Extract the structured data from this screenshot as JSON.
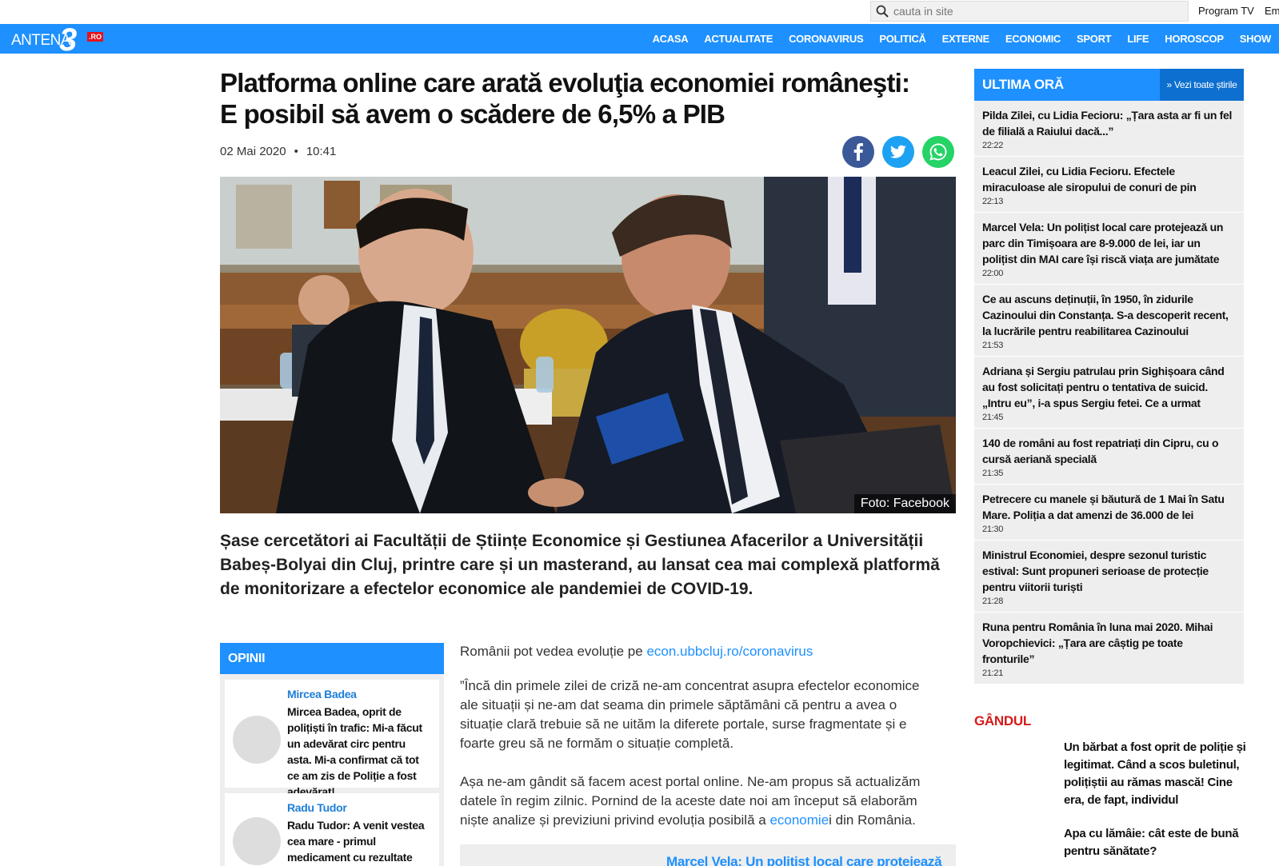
{
  "util": {
    "search_placeholder": "cauta in site",
    "program_tv": "Program TV",
    "em": "Em"
  },
  "logo": {
    "text": "ANTENA",
    "three": "3",
    "ro": ".RO"
  },
  "nav": [
    "ACASA",
    "ACTUALITATE",
    "CORONAVIRUS",
    "POLITICĂ",
    "EXTERNE",
    "ECONOMIC",
    "SPORT",
    "LIFE",
    "HOROSCOP",
    "SHOW"
  ],
  "article": {
    "headline": "Platforma online care arată evoluţia economiei româneşti: E posibil să avem o scădere de 6,5% a PIB",
    "date": "02 Mai 2020",
    "time": "10:41",
    "photo_credit": "Foto: Facebook",
    "lead": "Șase cercetători ai Facultății de Științe Economice și Gestiunea Afacerilor a Universității Babeș-Bolyai din Cluj, printre care și un masterand, au lansat cea mai complexă platformă de monitorizare a efectelor economice ale pandemiei de COVID-19.",
    "p1_prefix": "Românii pot vedea evoluție pe ",
    "p1_link": "econ.ubbcluj.ro/coronavirus",
    "p2": "”Încă din primele zilei de criză ne-am concentrat asupra efectelor economice ale situații și ne-am dat seama din primele săptămâni că pentru a avea o situație clară trebuie să ne uităm la diferete portale, surse fragmentate și e foarte greu să ne formăm o situație completă.",
    "p3_prefix": "Așa ne-am gândit să facem acest portal online. Ne-am propus să actualizăm datele în regim zilnic. Pornind de la aceste date noi am început să elaborăm niște analize și previziuni privind evoluția posibilă a ",
    "p3_link": "economie",
    "p3_suffix": "i din România.",
    "related": "Marcel Vela: Un polițist local care protejează"
  },
  "opinii": {
    "title": "OPINII",
    "items": [
      {
        "name": "Mircea Badea",
        "text": "Mircea Badea, oprit de polițiști în trafic: Mi-a făcut un adevărat circ pentru asta. Mi-a confirmat că tot ce am zis de Poliție a fost adevărat!"
      },
      {
        "name": "Radu Tudor",
        "text": "Radu Tudor: A venit vestea cea mare - primul medicament cu rezultate"
      }
    ]
  },
  "ultima_ora": {
    "title": "ULTIMA ORĂ",
    "see_all": "» Vezi toate știrile",
    "items": [
      {
        "title": "Pilda Zilei, cu Lidia Fecioru: „Țara asta ar fi un fel de filială a Raiului dacă...”",
        "time": "22:22"
      },
      {
        "title": "Leacul Zilei, cu Lidia Fecioru. Efectele miraculoase ale siropului de conuri de pin",
        "time": "22:13"
      },
      {
        "title": "Marcel Vela: Un polițist local care protejează un parc din Timișoara are 8-9.000 de lei, iar un polițist din MAI care își riscă viața are jumătate",
        "time": "22:00"
      },
      {
        "title": "Ce au ascuns deținuții, în 1950, în zidurile Cazinoului din Constanța. S-a descoperit recent, la lucrările pentru reabilitarea Cazinoului",
        "time": "21:53"
      },
      {
        "title": "Adriana și Sergiu patrulau prin Sighișoara când au fost solicitați pentru o tentativa de suicid. „Intru eu”, i-a spus Sergiu fetei. Ce a urmat",
        "time": "21:45"
      },
      {
        "title": "140 de români au fost repatriați din Cipru, cu o cursă aeriană specială",
        "time": "21:35"
      },
      {
        "title": "Petrecere cu manele și băutură de 1 Mai în Satu Mare. Poliția a dat amenzi de 36.000 de lei",
        "time": "21:30"
      },
      {
        "title": "Ministrul Economiei, despre sezonul turistic estival: Sunt propuneri serioase de protecție pentru viitorii turiști",
        "time": "21:28"
      },
      {
        "title": "Runa pentru România în luna mai 2020. Mihai Voropchievici: „Țara are câștig pe toate fronturile”",
        "time": "21:21"
      }
    ]
  },
  "gandul": {
    "title": "GÂNDUL",
    "items": [
      "Un bărbat a fost oprit de poliție și legitimat. Când a scos buletinul, polițiștii au rămas mască! Cine era, de fapt, individul",
      "Apa cu lămâie: cât este de bună pentru sănătate?"
    ]
  },
  "colors": {
    "accent": "#1e90ff",
    "facebook": "#3b5998",
    "twitter": "#1da1f2",
    "whatsapp": "#25d366",
    "gandul": "#d61a1a"
  }
}
